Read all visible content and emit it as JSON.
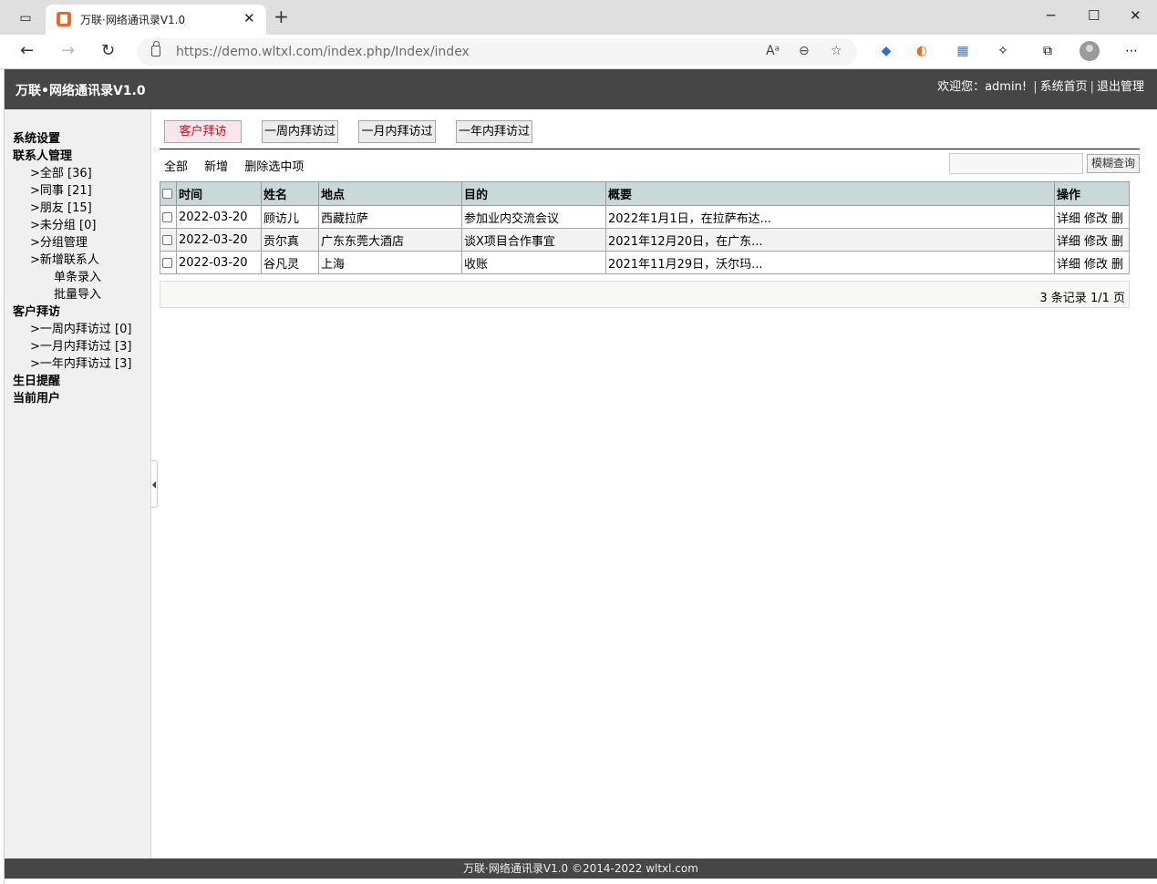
{
  "browser": {
    "tab_title": "万联·网络通讯录V1.0",
    "url_host": "https://demo.wltxl.com",
    "url_path": "/index.php/Index/index"
  },
  "header": {
    "title": "万联•网络通讯录V1.0",
    "welcome": "欢迎您：admin!",
    "home_link": "系统首页",
    "logout_link": "退出管理"
  },
  "sidebar": {
    "settings": "系统设置",
    "contacts_section": "联系人管理",
    "contacts": [
      ">全部 [36]",
      ">同事 [21]",
      ">朋友 [15]",
      ">未分组 [0]",
      ">分组管理",
      ">新增联系人"
    ],
    "add_sub": [
      "单条录入",
      "批量导入"
    ],
    "visits_section": "客户拜访",
    "visits": [
      ">一周内拜访过 [0]",
      ">一月内拜访过 [3]",
      ">一年内拜访过 [3]"
    ],
    "birthday": "生日提醒",
    "current_user": "当前用户"
  },
  "main": {
    "tabs": [
      "客户拜访",
      "一周内拜访过",
      "一月内拜访过",
      "一年内拜访过"
    ],
    "toolbar": {
      "all": "全部",
      "add": "新增",
      "delete_selected": "删除选中项"
    },
    "search": {
      "placeholder": "",
      "button": "模糊查询"
    },
    "columns": [
      "时间",
      "姓名",
      "地点",
      "目的",
      "概要",
      "操作"
    ],
    "rows": [
      {
        "time": "2022-03-20",
        "name": "顾访儿",
        "place": "西藏拉萨",
        "purpose": "参加业内交流会议",
        "summary": "2022年1月1日，在拉萨布达..."
      },
      {
        "time": "2022-03-20",
        "name": "贡尔真",
        "place": "广东东莞大酒店",
        "purpose": "谈X项目合作事宜",
        "summary": "2021年12月20日，在广东..."
      },
      {
        "time": "2022-03-20",
        "name": "谷凡灵",
        "place": "上海",
        "purpose": "收账",
        "summary": "2021年11月29日，沃尔玛..."
      }
    ],
    "actions": {
      "detail": "详细",
      "edit": "修改",
      "delete": "删"
    },
    "pager": "3 条记录 1/1 页"
  },
  "footer": "万联·网络通讯录V1.0 ©2014-2022 wltxl.com"
}
